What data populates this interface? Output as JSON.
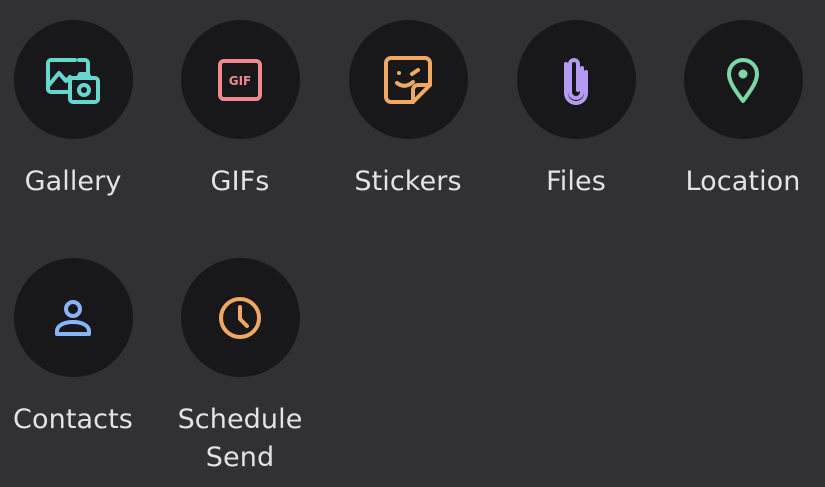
{
  "attach_menu": {
    "items": [
      {
        "label": "Gallery",
        "icon": "gallery-icon",
        "color": "#67d6ce"
      },
      {
        "label": "GIFs",
        "icon": "gif-icon",
        "color": "#f08a8f"
      },
      {
        "label": "Stickers",
        "icon": "sticker-icon",
        "color": "#f1a863"
      },
      {
        "label": "Files",
        "icon": "paperclip-icon",
        "color": "#b49af0"
      },
      {
        "label": "Location",
        "icon": "location-pin-icon",
        "color": "#7cd6a6"
      },
      {
        "label": "Contacts",
        "icon": "contact-icon",
        "color": "#8ab4f8"
      },
      {
        "label": "Schedule Send",
        "icon": "clock-icon",
        "color": "#f1a863"
      }
    ],
    "gif_badge_text": "GIF"
  }
}
